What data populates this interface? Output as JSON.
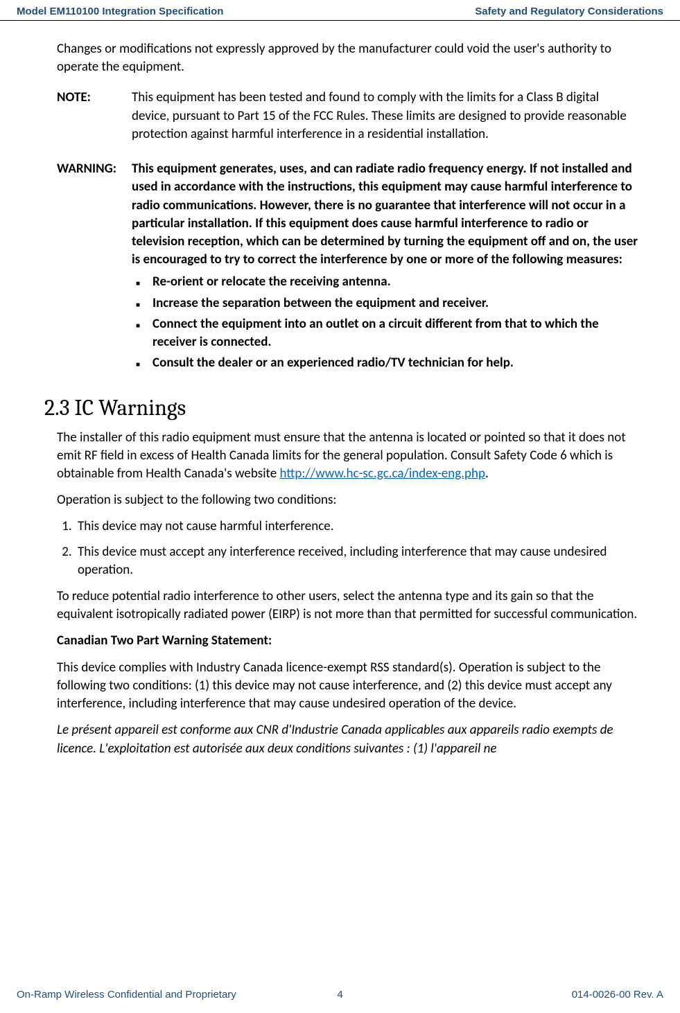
{
  "header": {
    "left": "Model EM110100 Integration Specification",
    "right": "Safety and Regulatory Considerations"
  },
  "body": {
    "intro": "Changes or modifications not expressly approved by the manufacturer could void the user's authority to operate the equipment.",
    "note": {
      "label": "NOTE:",
      "text": "This equipment has been tested and found to comply with the limits for a Class B digital device, pursuant to Part 15 of the FCC Rules. These limits are designed to provide reasonable protection against harmful interference in a residential installation."
    },
    "warning": {
      "label": "WARNING:",
      "text": "This equipment generates, uses, and can radiate radio frequency energy. If not installed and used in accordance with the instructions, this equipment may cause harmful interference to radio communications. However, there is no guarantee that interference will not occur in a particular installation. If this equipment does cause harmful interference to radio or television reception, which can be determined by turning the equipment off and on, the user is encouraged to try to correct the interference by one or more of the following measures:",
      "bullets": [
        "Re-orient or relocate the receiving antenna.",
        "Increase the separation between the equipment and receiver.",
        "Connect the equipment into an outlet on a circuit different from that to which the receiver is connected.",
        "Consult the dealer or an experienced radio/TV technician for help."
      ]
    },
    "section": {
      "heading": "2.3 IC Warnings",
      "p1_pre": "The installer of this radio equipment must ensure that the antenna is located or pointed so that it does not emit RF field in excess of Health Canada limits for the general population. Consult Safety Code 6 which is obtainable from Health Canada's website ",
      "p1_link": "http://www.hc-sc.gc.ca/index-eng.php",
      "p1_post": ".",
      "p2": "Operation is subject to the following two conditions:",
      "ol": [
        "This device may not cause harmful interference.",
        "This device must accept any interference received, including interference that may cause undesired operation."
      ],
      "p3": "To reduce potential radio interference to other users, select the antenna type and its gain so that the equivalent isotropically radiated power (EIRP) is not more than that permitted for successful communication.",
      "p4_title": "Canadian Two Part Warning Statement:",
      "p5": "This device complies with Industry Canada licence-exempt RSS standard(s). Operation is subject to the following two conditions: (1) this device may not cause interference, and (2) this device must accept any interference, including interference that may cause undesired operation of the device.",
      "p6": "Le présent appareil est conforme aux CNR d'Industrie Canada applicables aux appareils radio exempts de licence. L'exploitation est autorisée aux deux conditions suivantes : (1) l'appareil ne"
    }
  },
  "footer": {
    "left": "On-Ramp Wireless Confidential and Proprietary",
    "center": "4",
    "right": "014-0026-00 Rev. A"
  }
}
